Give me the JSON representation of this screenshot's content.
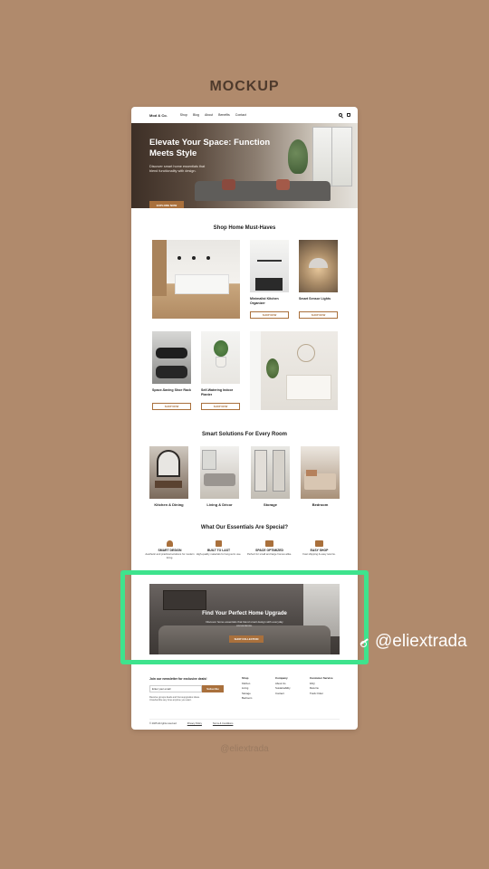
{
  "mockup_title": "MOCKUP",
  "nav": {
    "logo": "Mod & Co.",
    "links": [
      "Shop",
      "Blog",
      "About",
      "Benefits",
      "Contact"
    ]
  },
  "hero": {
    "title": "Elevate Your Space: Function Meets Style",
    "subtitle": "Discover smart home essentials that blend functionality with design.",
    "button": "EXPLORE NOW"
  },
  "must_haves": {
    "title": "Shop Home Must-Haves",
    "products": [
      {
        "name": "Minimalist Kitchen Organizer",
        "button": "SHOP NOW"
      },
      {
        "name": "Smart Sensor Lights",
        "button": "SHOP NOW"
      },
      {
        "name": "Space-Saving Shoe Rack",
        "button": "SHOP NOW"
      },
      {
        "name": "Self-Watering Indoor Planter",
        "button": "SHOP NOW"
      }
    ]
  },
  "rooms": {
    "title": "Smart Solutions For Every Room",
    "items": [
      "Kitchen & Dining",
      "Living & Décor",
      "Storage",
      "Bedroom"
    ]
  },
  "features": {
    "title": "What Our Essentials Are Special?",
    "items": [
      {
        "title": "SMART DESIGN",
        "desc": "Aesthetic and practical solutions for modern living."
      },
      {
        "title": "BUILT TO LAST",
        "desc": "High-quality materials for long-term use."
      },
      {
        "title": "SPACE OPTIMIZED",
        "desc": "Perfect for small and large homes alike."
      },
      {
        "title": "EASY SHOP",
        "desc": "Fast shipping & easy returns."
      }
    ]
  },
  "banner": {
    "title": "Find Your Perfect Home Upgrade",
    "subtitle": "Discover home essentials that blend smart design with everyday convenience.",
    "button": "SHOP COLLECTION"
  },
  "footer": {
    "newsletter_title": "Join our newsletter for exclusive deals!",
    "email_placeholder": "Enter your email",
    "subscribe": "Subscribe",
    "newsletter_note": "Receive groups deals and homeupgrades ideas. Unsubscribe any time anytime you want.",
    "columns": [
      {
        "heading": "Shop",
        "items": [
          "Kitchen",
          "Living",
          "Storage",
          "Bedroom"
        ]
      },
      {
        "heading": "Company",
        "items": [
          "About Us",
          "Sustainability",
          "Contact"
        ]
      },
      {
        "heading": "Customer Service",
        "items": [
          "FAQ",
          "Returns",
          "Track Order"
        ]
      }
    ],
    "copyright": "© 2025 All rights reserved",
    "privacy": "Privacy Policy",
    "terms": "Terms & Conditions"
  },
  "overlay": {
    "username": "@eliextrada",
    "watermark": "@eliextrada"
  },
  "colors": {
    "background": "#b08a6c",
    "accent": "#a9703c",
    "highlight": "#3ee38d"
  }
}
